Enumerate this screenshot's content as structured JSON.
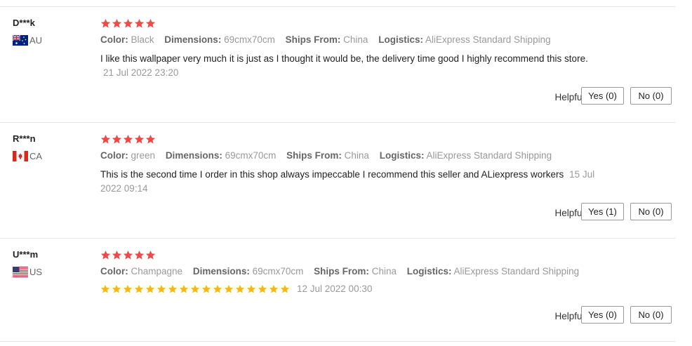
{
  "colors": {
    "star_red": "#ee4a4a",
    "star_yellow": "#f5b81c",
    "divider": "#e8e8e8"
  },
  "labels": {
    "color": "Color:",
    "dimensions": "Dimensions:",
    "ships_from": "Ships From:",
    "logistics": "Logistics:",
    "helpful": "Helpful?"
  },
  "reviews": [
    {
      "user": "D***k",
      "country": "AU",
      "flag": "australia-flag-icon",
      "rating": 5,
      "color": "Black",
      "dimensions": "69cmx70cm",
      "ships_from": "China",
      "logistics": "AliExpress Standard Shipping",
      "text": "I like this wallpaper very much it is just as I thought it would be, the delivery time good I highly recommend this store.",
      "date": "21 Jul 2022 23:20",
      "yes": "Yes (0)",
      "no": "No (0)"
    },
    {
      "user": "R***n",
      "country": "CA",
      "flag": "canada-flag-icon",
      "rating": 5,
      "color": "green",
      "dimensions": "69cmx70cm",
      "ships_from": "China",
      "logistics": "AliExpress Standard Shipping",
      "text": "This is the second time I order in this shop always impeccable I recommend this seller and ALiexpress workers",
      "date": "15 Jul 2022 09:14",
      "yes": "Yes (1)",
      "no": "No (0)"
    },
    {
      "user": "U***m",
      "country": "US",
      "flag": "us-flag-icon",
      "rating": 5,
      "color": "Champagne",
      "dimensions": "69cmx70cm",
      "ships_from": "China",
      "logistics": "AliExpress Standard Shipping",
      "text_star_count": 17,
      "date": "12 Jul 2022 00:30",
      "yes": "Yes (0)",
      "no": "No (0)"
    }
  ]
}
